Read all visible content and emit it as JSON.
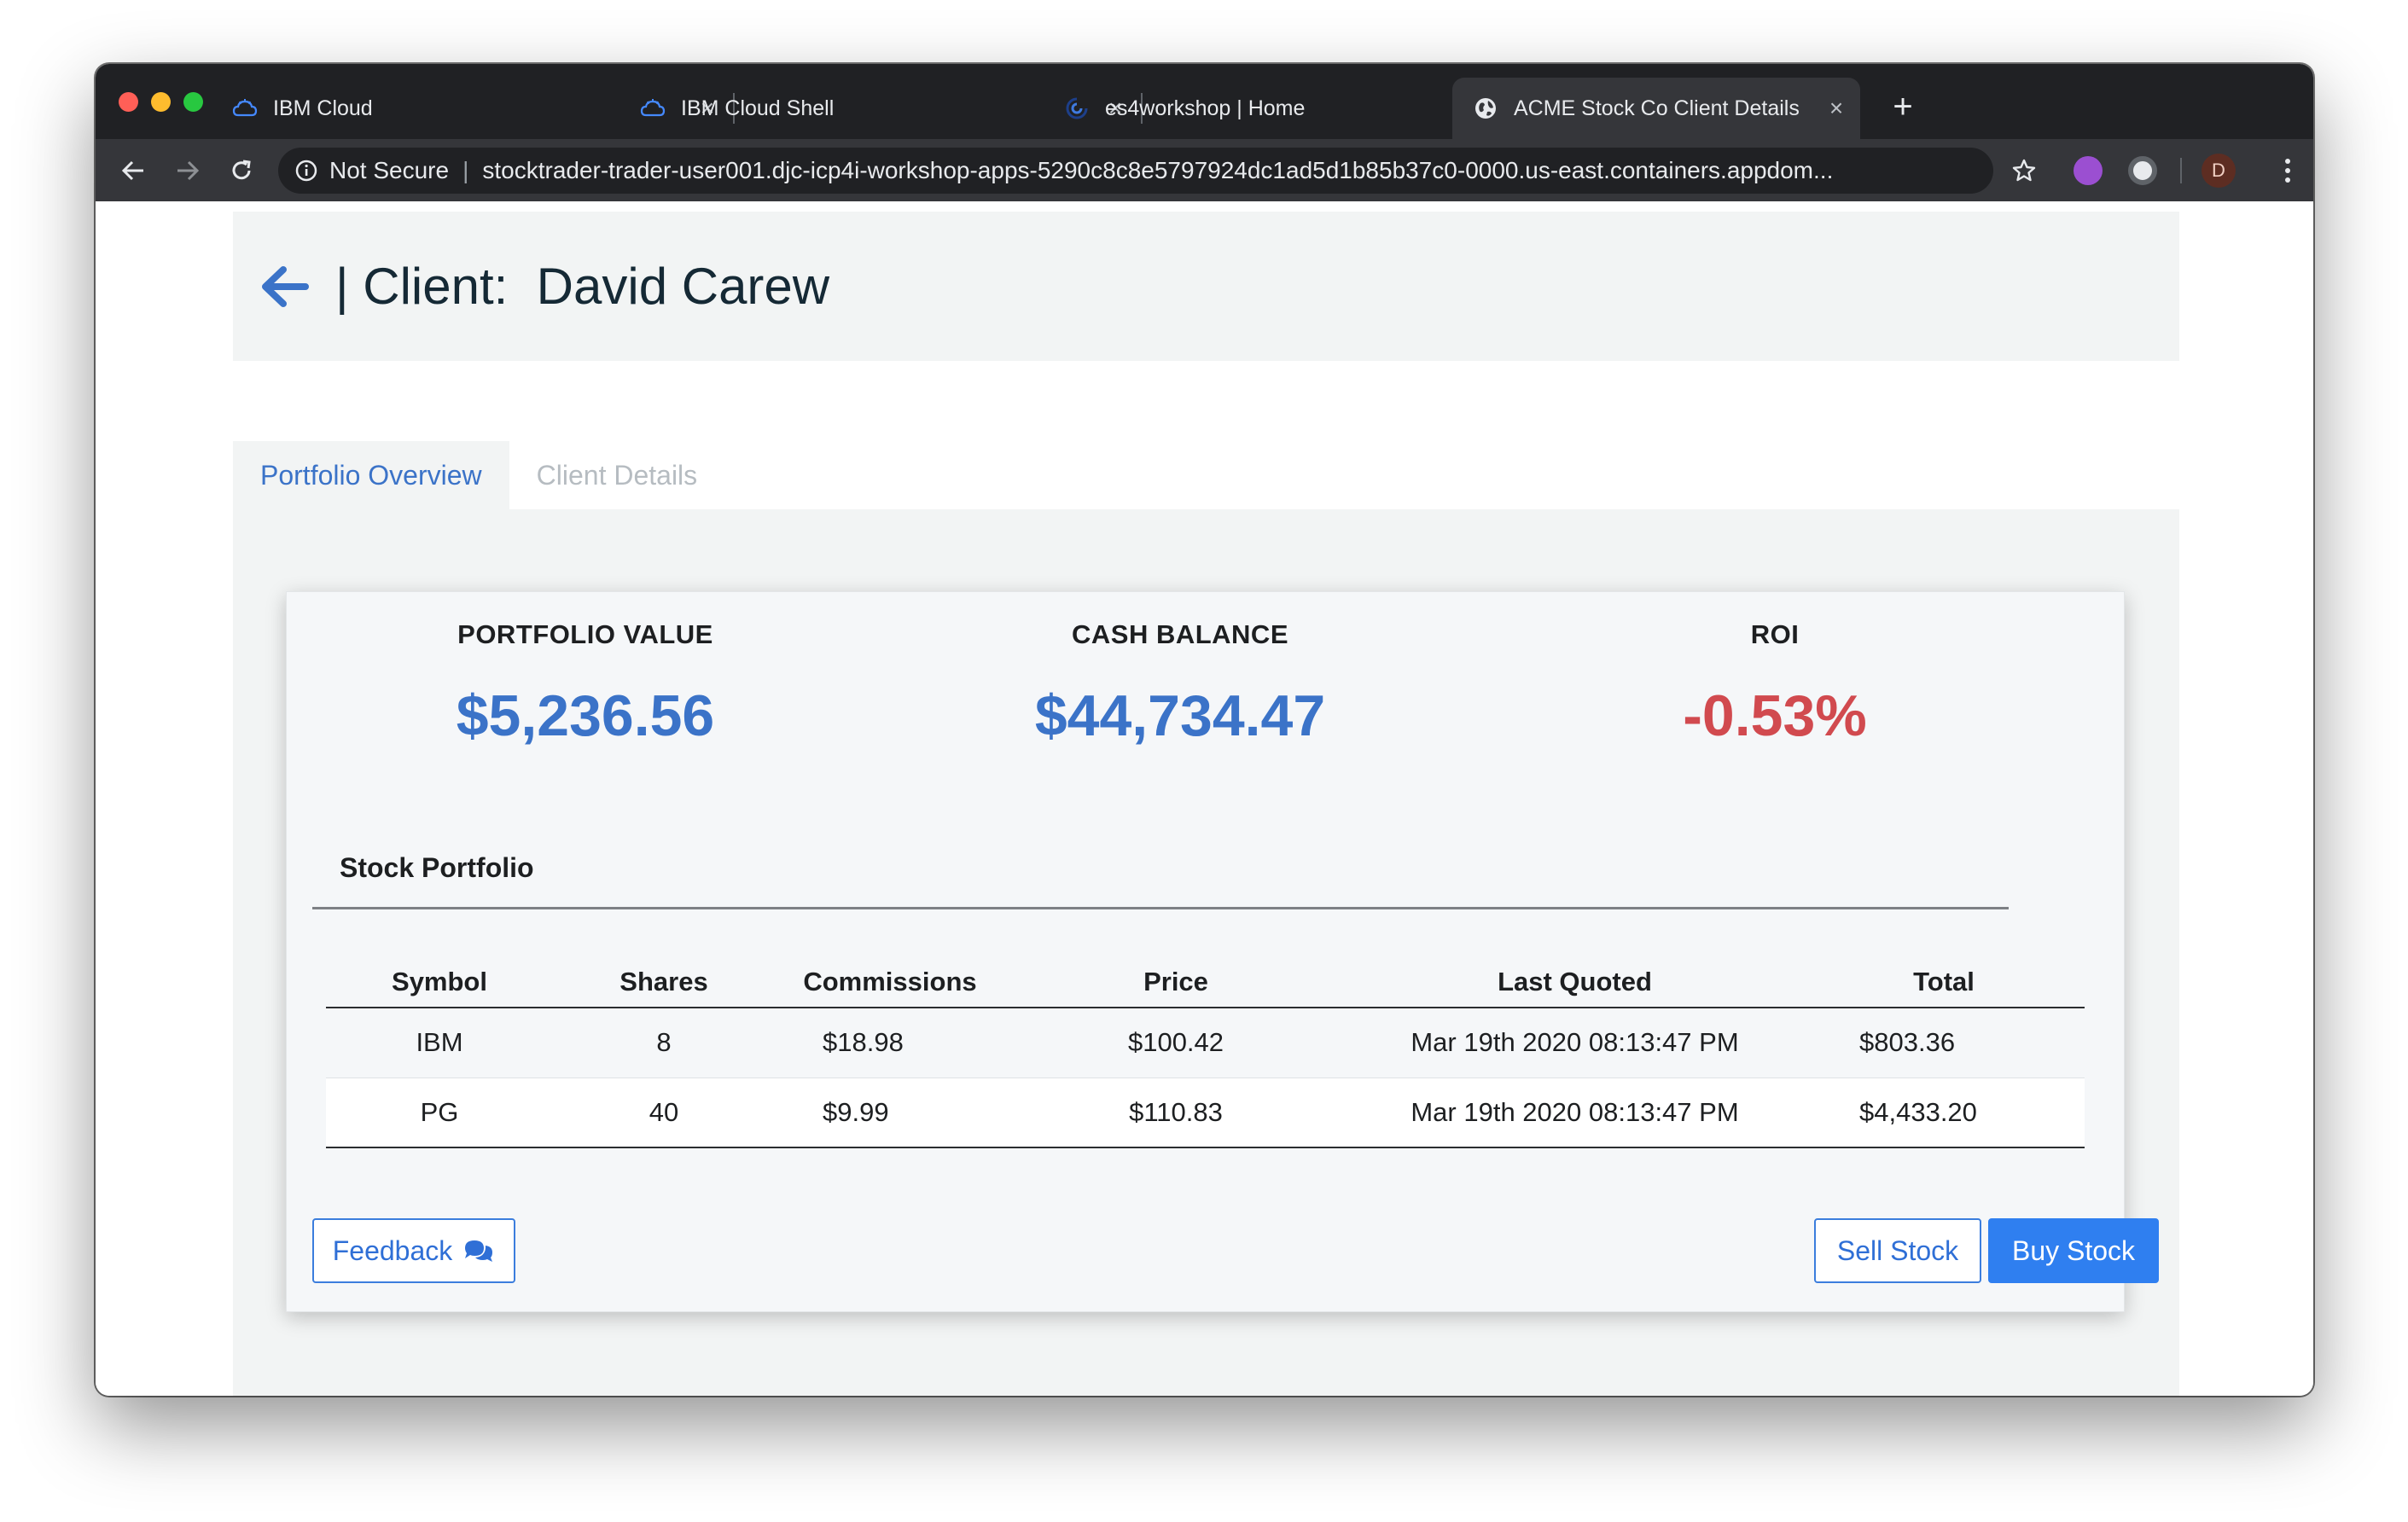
{
  "browser": {
    "tabs": [
      {
        "title": "IBM Cloud",
        "icon": "ibm-cloud-icon"
      },
      {
        "title": "IBM Cloud Shell",
        "icon": "ibm-cloud-icon"
      },
      {
        "title": "es4workshop | Home",
        "icon": "event-streams-icon"
      },
      {
        "title": "ACME Stock Co Client Details",
        "icon": "globe-icon",
        "active": true
      }
    ],
    "security_label": "Not Secure",
    "url": "stocktrader-trader-user001.djc-icp4i-workshop-apps-5290c8c8e5797924dc1ad5d1b85b37c0-0000.us-east.containers.appdom...",
    "profile_initial": "D"
  },
  "header": {
    "title": "| Client:  David Carew"
  },
  "tabs": [
    {
      "label": "Portfolio Overview",
      "active": true
    },
    {
      "label": "Client Details",
      "active": false
    }
  ],
  "summary": {
    "portfolio_value_label": "PORTFOLIO VALUE",
    "portfolio_value": "$5,236.56",
    "cash_balance_label": "CASH BALANCE",
    "cash_balance": "$44,734.47",
    "roi_label": "ROI",
    "roi": "-0.53%"
  },
  "portfolio": {
    "title": "Stock Portfolio",
    "columns": [
      "Symbol",
      "Shares",
      "Commissions",
      "Price",
      "Last Quoted",
      "Total"
    ],
    "rows": [
      {
        "symbol": "IBM",
        "shares": "8",
        "commissions": "$18.98",
        "price": "$100.42",
        "last_quoted": "Mar 19th 2020 08:13:47 PM",
        "total": "$803.36"
      },
      {
        "symbol": "PG",
        "shares": "40",
        "commissions": "$9.99",
        "price": "$110.83",
        "last_quoted": "Mar 19th 2020 08:13:47 PM",
        "total": "$4,433.20"
      }
    ]
  },
  "buttons": {
    "feedback": "Feedback",
    "sell": "Sell Stock",
    "buy": "Buy Stock"
  },
  "colors": {
    "accent_blue": "#3b73c8",
    "negative_red": "#d14a4f",
    "primary_button": "#2f7ff0"
  }
}
